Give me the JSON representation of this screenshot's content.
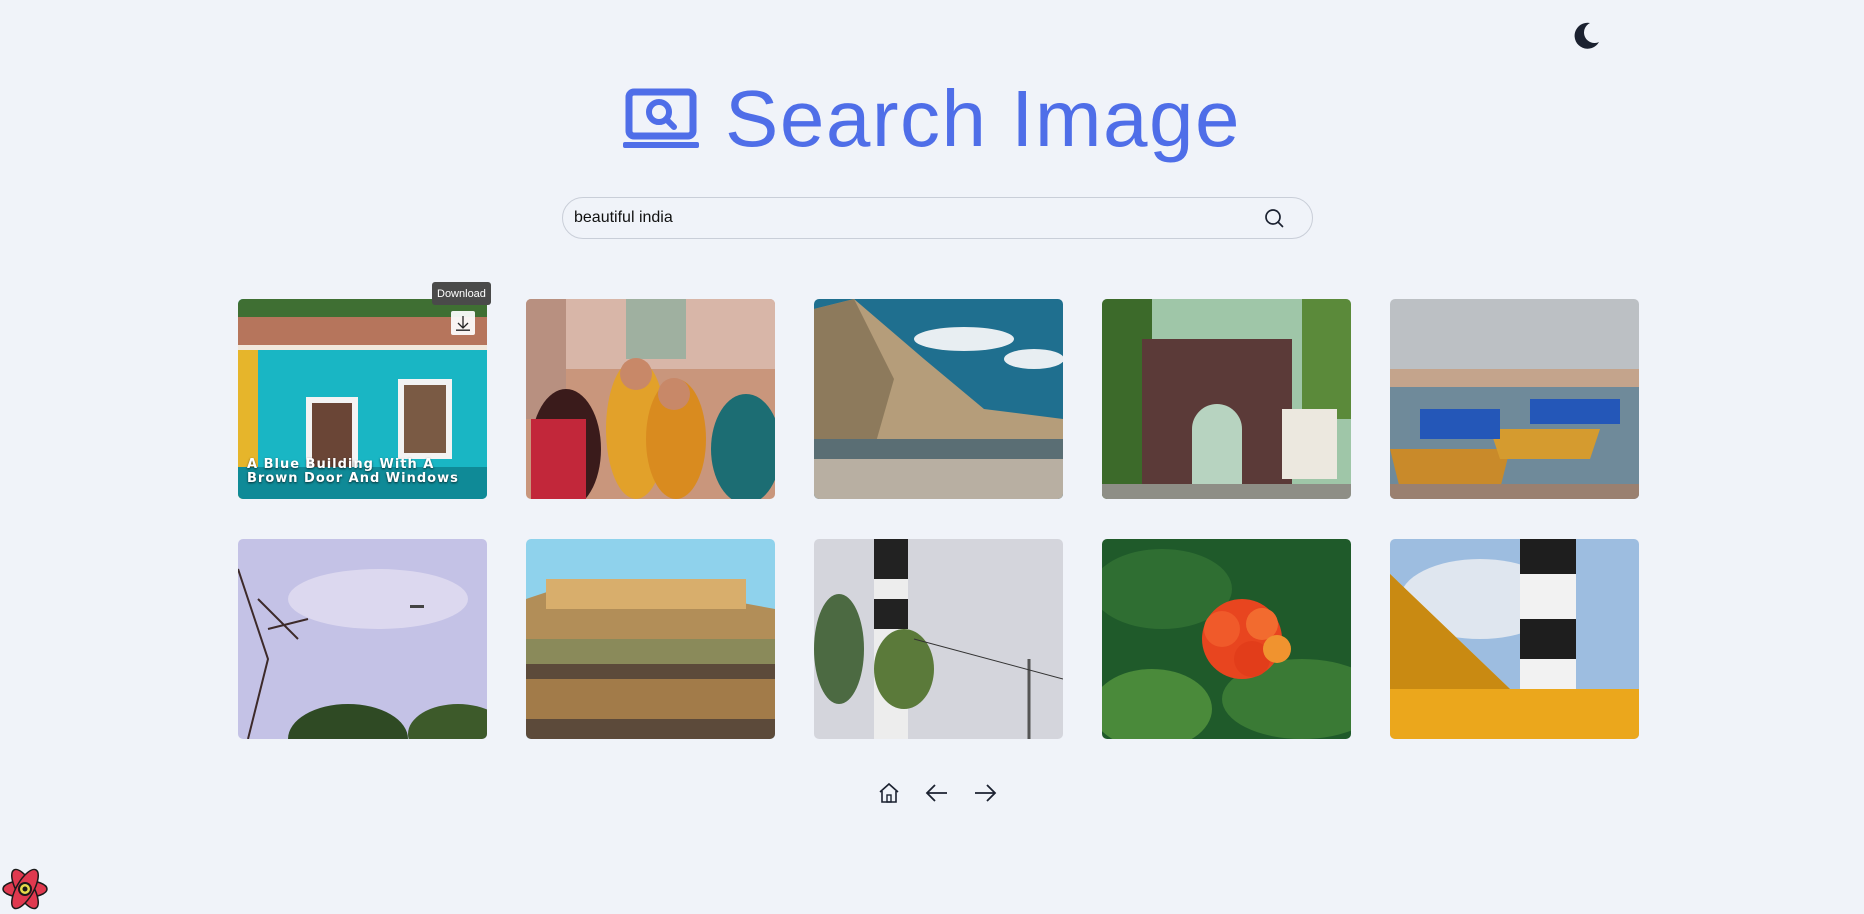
{
  "header": {
    "title": "Search Image"
  },
  "search": {
    "value": "beautiful india"
  },
  "tooltip": {
    "download_label": "Download"
  },
  "cards": [
    {
      "caption": "A Blue Building With A Brown Door And Windows"
    }
  ],
  "icons": {
    "theme_toggle": "moon-icon",
    "logo": "laptop-search-icon",
    "search": "search-icon",
    "download": "download-arrow-icon",
    "home": "home-icon",
    "prev": "arrow-left-icon",
    "next": "arrow-right-icon",
    "corner_logo": "react-logo-icon"
  },
  "colors": {
    "accent": "#4f6ee8",
    "background": "#f0f3f9"
  }
}
